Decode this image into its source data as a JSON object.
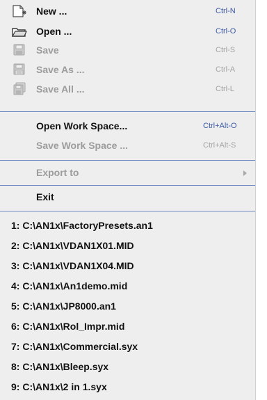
{
  "menu": {
    "new": {
      "label": "New ...",
      "shortcut": "Ctrl-N",
      "icon": "new-document-icon",
      "enabled": true
    },
    "open": {
      "label": "Open ...",
      "shortcut": "Ctrl-O",
      "icon": "open-folder-icon",
      "enabled": true
    },
    "save": {
      "label": "Save",
      "shortcut": "Ctrl-S",
      "icon": "floppy-disk-icon",
      "enabled": false
    },
    "save_as": {
      "label": "Save As ...",
      "shortcut": "Ctrl-A",
      "icon": "save-as-icon",
      "enabled": false
    },
    "save_all": {
      "label": "Save All ...",
      "shortcut": "Ctrl-L",
      "icon": "save-all-icon",
      "enabled": false
    },
    "open_workspace": {
      "label": "Open Work Space...",
      "shortcut": "Ctrl+Alt-O",
      "enabled": true
    },
    "save_workspace": {
      "label": "Save Work Space ...",
      "shortcut": "Ctrl+Alt-S",
      "enabled": false
    },
    "export_to": {
      "label": "Export to",
      "enabled": false
    },
    "exit": {
      "label": "Exit",
      "enabled": true
    },
    "recent_files": [
      "1: C:\\AN1x\\FactoryPresets.an1",
      "2: C:\\AN1x\\VDAN1X01.MID",
      "3: C:\\AN1x\\VDAN1X04.MID",
      "4: C:\\AN1x\\An1demo.mid",
      "5: C:\\AN1x\\JP8000.an1",
      "6: C:\\AN1x\\Rol_Impr.mid",
      "7: C:\\AN1x\\Commercial.syx",
      "8: C:\\AN1x\\Bleep.syx",
      "9: C:\\AN1x\\2 in 1.syx"
    ]
  },
  "colors": {
    "menu_background": "#eeeeee",
    "text": "#111111",
    "disabled_text": "#9c9c9c",
    "shortcut": "#3c5aa6",
    "separator": "#6f87c2"
  }
}
